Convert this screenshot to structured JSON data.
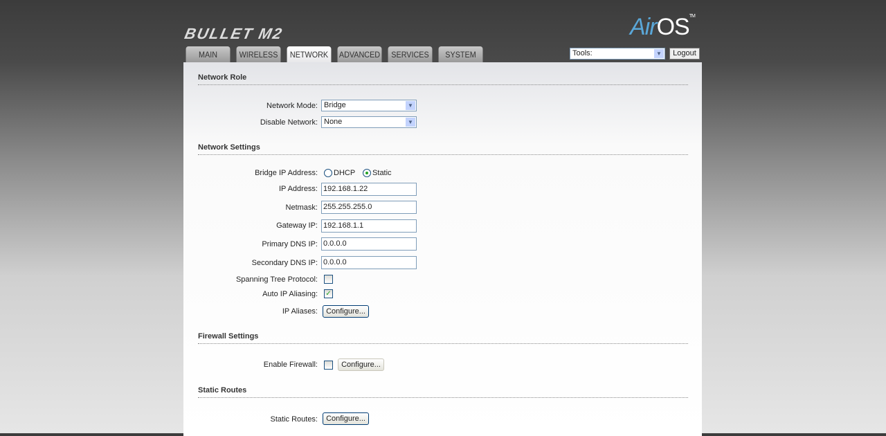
{
  "header": {
    "product_logo": "BULLET M2",
    "brand_logo": "AirOS",
    "tools_value": "Tools:",
    "logout_label": "Logout"
  },
  "tabs": [
    "MAIN",
    "WIRELESS",
    "NETWORK",
    "ADVANCED",
    "SERVICES",
    "SYSTEM"
  ],
  "network_role": {
    "title": "Network Role",
    "mode_label": "Network Mode:",
    "mode_value": "Bridge",
    "disable_label": "Disable Network:",
    "disable_value": "None"
  },
  "network_settings": {
    "title": "Network Settings",
    "bridge_ip_label": "Bridge IP Address:",
    "dhcp_label": "DHCP",
    "static_label": "Static",
    "ip_label": "IP Address:",
    "ip_value": "192.168.1.22",
    "netmask_label": "Netmask:",
    "netmask_value": "255.255.255.0",
    "gateway_label": "Gateway IP:",
    "gateway_value": "192.168.1.1",
    "dns1_label": "Primary DNS IP:",
    "dns1_value": "0.0.0.0",
    "dns2_label": "Secondary DNS IP:",
    "dns2_value": "0.0.0.0",
    "stp_label": "Spanning Tree Protocol:",
    "alias_auto_label": "Auto IP Aliasing:",
    "aliases_label": "IP Aliases:",
    "configure_label": "Configure..."
  },
  "firewall": {
    "title": "Firewall Settings",
    "enable_label": "Enable Firewall:",
    "configure_label": "Configure..."
  },
  "routes": {
    "title": "Static Routes",
    "label": "Static Routes:",
    "configure_label": "Configure..."
  }
}
